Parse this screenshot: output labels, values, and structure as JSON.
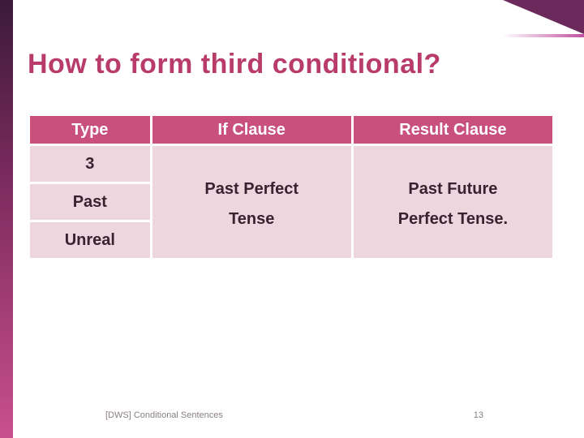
{
  "title": "How to form third conditional?",
  "table": {
    "headers": {
      "type": "Type",
      "if_clause": "If Clause",
      "result_clause": "Result Clause"
    },
    "type_cells": [
      "3",
      "Past",
      "Unreal"
    ],
    "if_cells": [
      "Past Perfect",
      "Tense"
    ],
    "result_cells": [
      "Past Future",
      "Perfect Tense."
    ]
  },
  "footer": {
    "source": "[DWS] Conditional Sentences",
    "page_number": "13"
  }
}
